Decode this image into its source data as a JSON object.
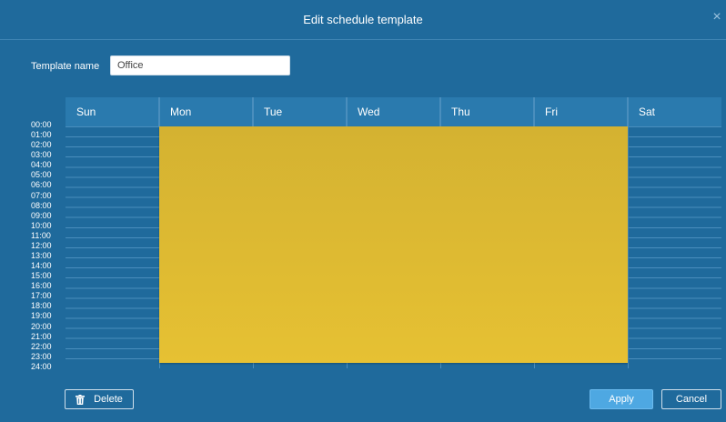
{
  "dialog": {
    "title": "Edit schedule template",
    "close_symbol": "×"
  },
  "form": {
    "template_name_label": "Template name",
    "template_name_value": "Office"
  },
  "schedule": {
    "days": [
      "Sun",
      "Mon",
      "Tue",
      "Wed",
      "Thu",
      "Fri",
      "Sat"
    ],
    "hours": [
      "00:00",
      "01:00",
      "02:00",
      "03:00",
      "04:00",
      "05:00",
      "06:00",
      "07:00",
      "08:00",
      "09:00",
      "10:00",
      "11:00",
      "12:00",
      "13:00",
      "14:00",
      "15:00",
      "16:00",
      "17:00",
      "18:00",
      "19:00",
      "20:00",
      "21:00",
      "22:00",
      "23:00",
      "24:00"
    ],
    "selected_blocks": [
      {
        "from_day": "Mon",
        "to_day": "Fri",
        "start": "00:00",
        "end": "24:00",
        "color": "#e1bd33"
      }
    ]
  },
  "buttons": {
    "delete": "Delete",
    "apply": "Apply",
    "cancel": "Cancel"
  },
  "colors": {
    "background": "#1f6a9c",
    "header": "#2a7aae",
    "accent": "#4ea8e2",
    "selection": "#e1bd33"
  }
}
